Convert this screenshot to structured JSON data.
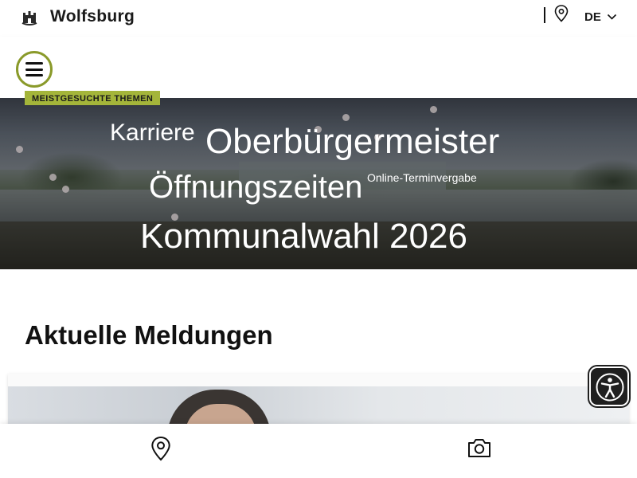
{
  "header": {
    "logo_text": "Wolfsburg",
    "language": "DE"
  },
  "hero": {
    "badge": "MEISTGESUCHTE THEMEN",
    "links": {
      "karriere": "Karriere",
      "oberbuergermeister": "Oberbürgermeister",
      "oeffnungszeiten": "Öffnungszeiten",
      "online_terminvergabe": "Online-Terminvergabe",
      "kommunalwahl": "Kommunalwahl 2026"
    }
  },
  "news": {
    "title": "Aktuelle Meldungen"
  },
  "colors": {
    "accent": "#a4b53a",
    "menu_ring": "#8a9a2a",
    "a11y_bg": "#1f1f1f"
  },
  "icons": {
    "logo": "wolfsburg-castle-icon",
    "location": "map-pin-icon",
    "language_toggle": "chevron-down-icon",
    "menu": "hamburger-icon",
    "accessibility": "accessibility-icon",
    "camera": "camera-icon"
  }
}
